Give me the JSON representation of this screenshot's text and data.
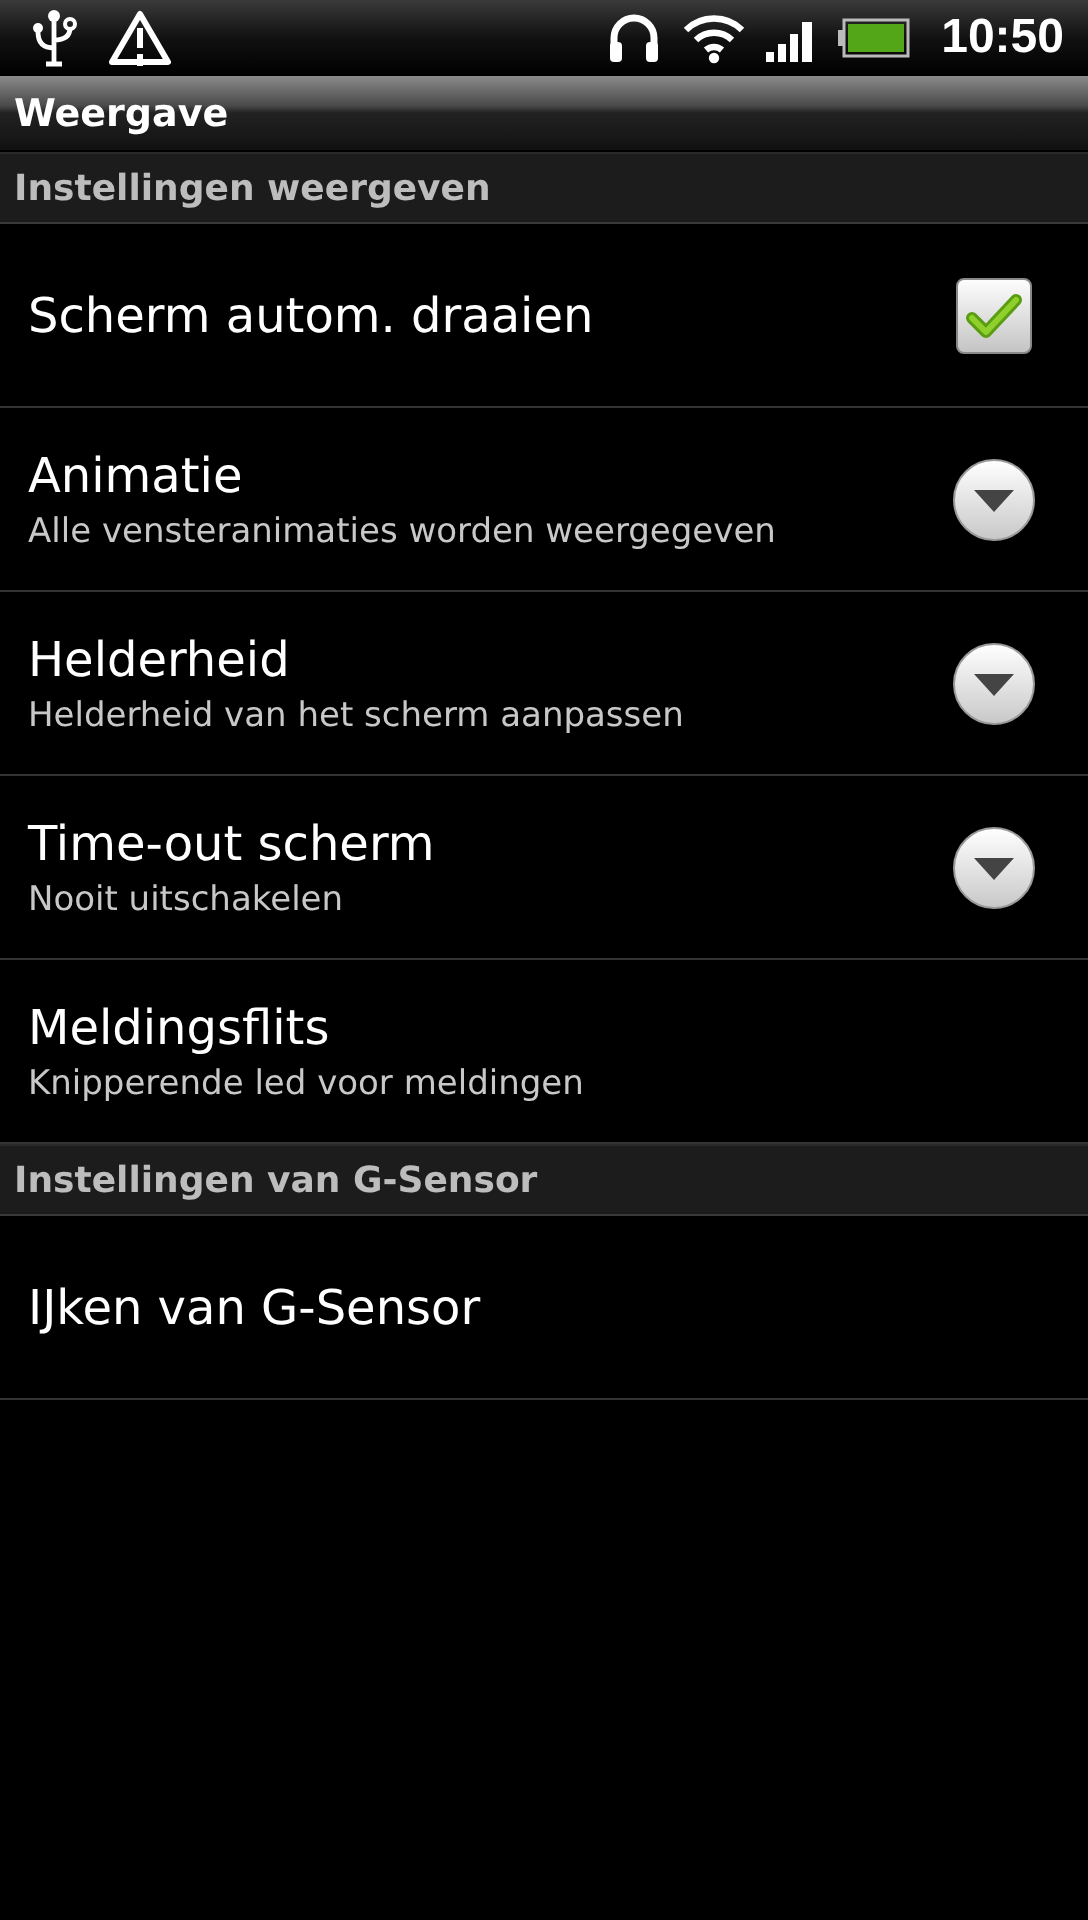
{
  "status_bar": {
    "time": "10:50"
  },
  "window": {
    "title": "Weergave"
  },
  "sections": [
    {
      "header": "Instellingen weergeven",
      "items": [
        {
          "kind": "checkbox",
          "title": "Scherm autom. draaien",
          "checked": true
        },
        {
          "kind": "dropdown",
          "title": "Animatie",
          "summary": "Alle vensteranimaties worden weergegeven"
        },
        {
          "kind": "dropdown",
          "title": "Helderheid",
          "summary": "Helderheid van het scherm aanpassen"
        },
        {
          "kind": "dropdown",
          "title": "Time-out scherm",
          "summary": "Nooit uitschakelen"
        },
        {
          "kind": "plain",
          "title": "Meldingsflits",
          "summary": "Knipperende led voor meldingen"
        }
      ]
    },
    {
      "header": "Instellingen van G-Sensor",
      "items": [
        {
          "kind": "plain",
          "title": "IJken van G-Sensor"
        }
      ]
    }
  ]
}
